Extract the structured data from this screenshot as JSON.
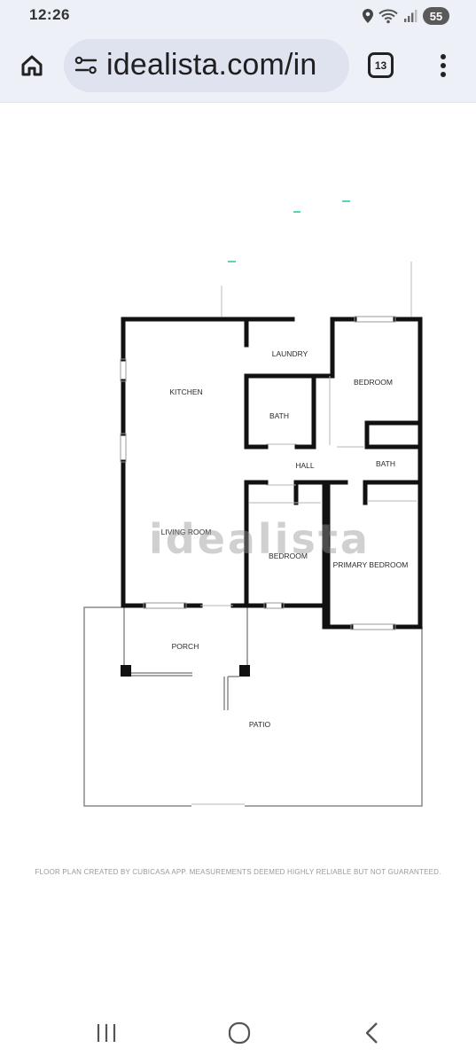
{
  "status_bar": {
    "time": "12:26",
    "battery": "55",
    "icons": [
      "location-icon",
      "wifi-icon",
      "signal-icon",
      "battery-icon"
    ]
  },
  "browser": {
    "url": "idealista.com/in",
    "tab_count": "13",
    "icons": [
      "home-icon",
      "site-settings-icon",
      "tabs-icon",
      "more-vert-icon"
    ]
  },
  "floorplan": {
    "rooms": {
      "laundry": "LAUNDRY",
      "kitchen": "KITCHEN",
      "bedroom": "BEDROOM",
      "bath_1": "BATH",
      "hall": "HALL",
      "bath_2": "BATH",
      "living_room": "LIVING ROOM",
      "bedroom_2": "BEDROOM",
      "primary_bedroom": "PRIMARY BEDROOM",
      "porch": "PORCH",
      "patio": "PATIO"
    },
    "watermark": "idealista",
    "footnote": "FLOOR PLAN CREATED BY CUBICASA APP. MEASUREMENTS DEEMED HIGHLY RELIABLE BUT NOT GUARANTEED."
  },
  "nav_bar": {
    "icons": [
      "recent-apps-icon",
      "home-circle-icon",
      "back-icon"
    ]
  },
  "colors": {
    "chrome_bg": "#eef0f8",
    "url_bar_bg": "#dfe2ef",
    "wall": "#111111",
    "accent_mark": "#1ec8a0"
  }
}
